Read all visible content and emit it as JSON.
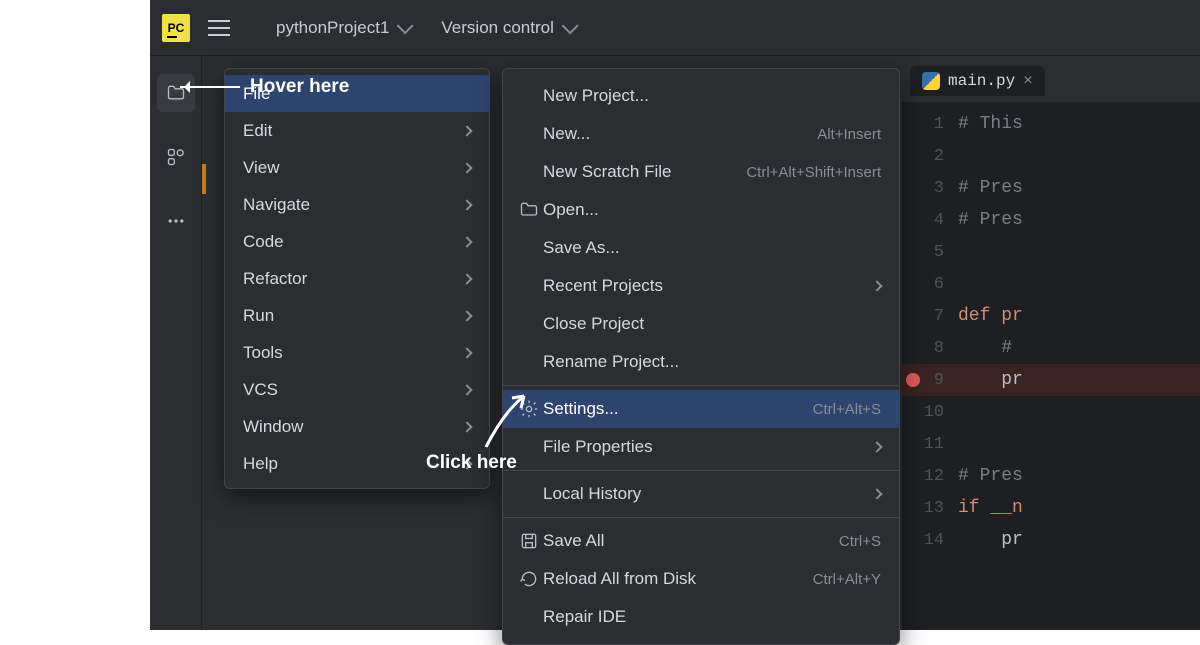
{
  "topbar": {
    "project_name": "pythonProject1",
    "vcs_label": "Version control"
  },
  "mainmenu": [
    {
      "label": "File",
      "has_sub": false,
      "highlight": true
    },
    {
      "label": "Edit",
      "has_sub": true
    },
    {
      "label": "View",
      "has_sub": true
    },
    {
      "label": "Navigate",
      "has_sub": true
    },
    {
      "label": "Code",
      "has_sub": true
    },
    {
      "label": "Refactor",
      "has_sub": true
    },
    {
      "label": "Run",
      "has_sub": true
    },
    {
      "label": "Tools",
      "has_sub": true
    },
    {
      "label": "VCS",
      "has_sub": true
    },
    {
      "label": "Window",
      "has_sub": true
    },
    {
      "label": "Help",
      "has_sub": true
    }
  ],
  "submenu": [
    {
      "type": "item",
      "label": "New Project..."
    },
    {
      "type": "item",
      "label": "New...",
      "shortcut": "Alt+Insert"
    },
    {
      "type": "item",
      "label": "New Scratch File",
      "shortcut": "Ctrl+Alt+Shift+Insert"
    },
    {
      "type": "item",
      "label": "Open...",
      "icon": "folder"
    },
    {
      "type": "item",
      "label": "Save As..."
    },
    {
      "type": "item",
      "label": "Recent Projects",
      "submenu": true
    },
    {
      "type": "item",
      "label": "Close Project"
    },
    {
      "type": "item",
      "label": "Rename Project..."
    },
    {
      "type": "sep"
    },
    {
      "type": "item",
      "label": "Settings...",
      "shortcut": "Ctrl+Alt+S",
      "icon": "gear",
      "highlight": true
    },
    {
      "type": "item",
      "label": "File Properties",
      "submenu": true
    },
    {
      "type": "sep"
    },
    {
      "type": "item",
      "label": "Local History",
      "submenu": true
    },
    {
      "type": "sep"
    },
    {
      "type": "item",
      "label": "Save All",
      "shortcut": "Ctrl+S",
      "icon": "save"
    },
    {
      "type": "item",
      "label": "Reload All from Disk",
      "shortcut": "Ctrl+Alt+Y",
      "icon": "reload"
    },
    {
      "type": "item",
      "label": "Repair IDE"
    }
  ],
  "editor": {
    "tab_name": "main.py",
    "lines": [
      {
        "n": 1,
        "cls": "cm",
        "text": "# This"
      },
      {
        "n": 2,
        "cls": "",
        "text": ""
      },
      {
        "n": 3,
        "cls": "cm",
        "text": "# Pres"
      },
      {
        "n": 4,
        "cls": "cm",
        "text": "# Pres"
      },
      {
        "n": 5,
        "cls": "",
        "text": ""
      },
      {
        "n": 6,
        "cls": "",
        "text": ""
      },
      {
        "n": 7,
        "cls": "kw",
        "text": "def pr"
      },
      {
        "n": 8,
        "cls": "cm",
        "text": "    # "
      },
      {
        "n": 9,
        "cls": "",
        "text": "    pr",
        "bp": true,
        "hl": true
      },
      {
        "n": 10,
        "cls": "",
        "text": ""
      },
      {
        "n": 11,
        "cls": "",
        "text": ""
      },
      {
        "n": 12,
        "cls": "cm",
        "text": "# Pres"
      },
      {
        "n": 13,
        "cls": "kw",
        "text": "if __n"
      },
      {
        "n": 14,
        "cls": "",
        "text": "    pr"
      }
    ]
  },
  "annotations": {
    "hover_text": "Hover here",
    "click_text": "Click here"
  }
}
